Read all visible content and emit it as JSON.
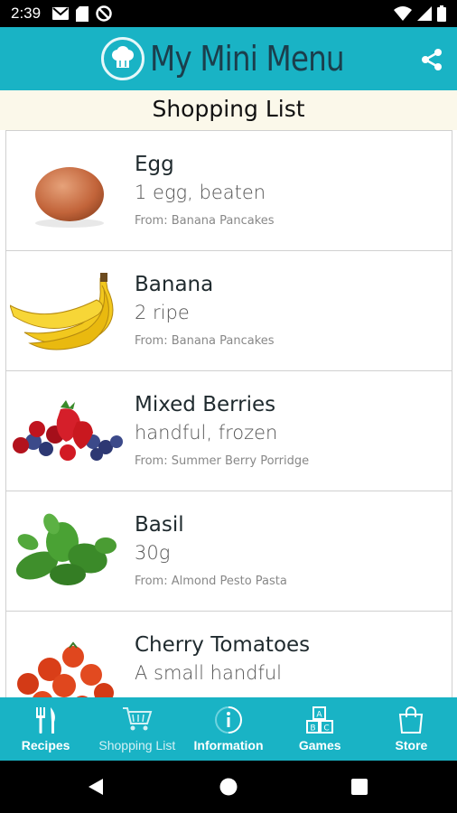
{
  "status_bar": {
    "time": "2:39",
    "left_icons": [
      "gmail-icon",
      "sd-card-icon",
      "dnd-icon"
    ],
    "right_icons": [
      "wifi-icon",
      "signal-icon",
      "battery-icon"
    ]
  },
  "app_bar": {
    "logo_text": "My Mini Menu",
    "share_icon": "share-icon",
    "color": "#19b3c5"
  },
  "page": {
    "title": "Shopping List"
  },
  "items": [
    {
      "name": "Egg",
      "qty": "1 egg, beaten",
      "from": "From: Banana Pancakes",
      "image": "egg"
    },
    {
      "name": "Banana",
      "qty": "2 ripe",
      "from": "From: Banana Pancakes",
      "image": "banana"
    },
    {
      "name": "Mixed Berries",
      "qty": "handful, frozen",
      "from": "From: Summer Berry Porridge",
      "image": "berries"
    },
    {
      "name": "Basil",
      "qty": "30g",
      "from": "From: Almond Pesto Pasta",
      "image": "basil"
    },
    {
      "name": "Cherry Tomatoes",
      "qty": "A small handful",
      "from": "",
      "image": "cherry-tomatoes"
    }
  ],
  "bottom_nav": [
    {
      "label": "Recipes",
      "icon": "fork-knife-icon",
      "active": false
    },
    {
      "label": "Shopping List",
      "icon": "cart-icon",
      "active": true
    },
    {
      "label": "Information",
      "icon": "info-icon",
      "active": false
    },
    {
      "label": "Games",
      "icon": "blocks-icon",
      "active": false
    },
    {
      "label": "Store",
      "icon": "bag-icon",
      "active": false
    }
  ],
  "system_nav": [
    "back-icon",
    "home-icon",
    "recents-icon"
  ]
}
